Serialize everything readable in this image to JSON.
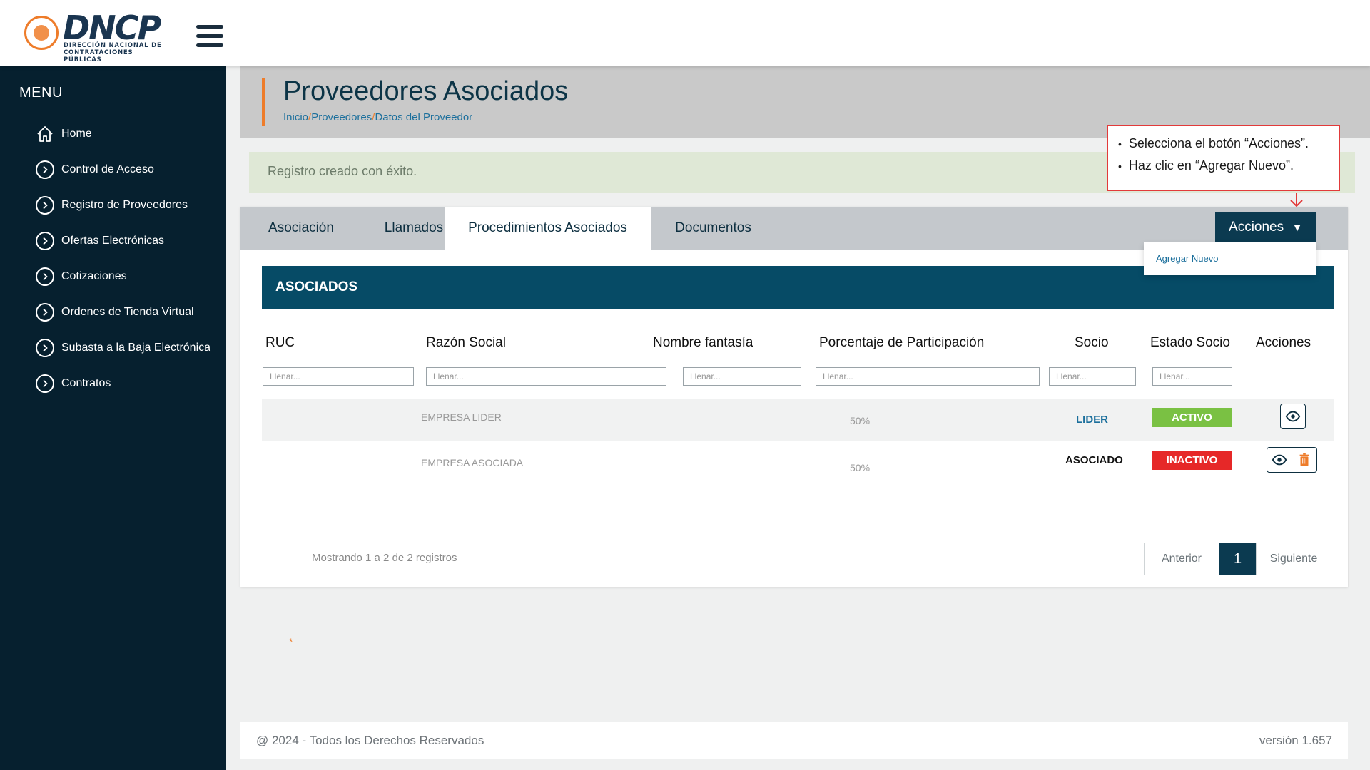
{
  "brand": {
    "logo_name": "DNCP",
    "logo_subtitle_1": "DIRECCIÓN NACIONAL DE",
    "logo_subtitle_2": "CONTRATACIONES PÚBLICAS",
    "accent_color": "#ee7c2a",
    "primary_color": "#0b3a50"
  },
  "sidebar": {
    "title": "MENU",
    "items": [
      {
        "label": "Home",
        "icon": "home-icon"
      },
      {
        "label": "Control de Acceso",
        "icon": "chevron-right-circle-icon"
      },
      {
        "label": "Registro de Proveedores",
        "icon": "chevron-right-circle-icon"
      },
      {
        "label": "Ofertas Electrónicas",
        "icon": "chevron-right-circle-icon"
      },
      {
        "label": "Cotizaciones",
        "icon": "chevron-right-circle-icon"
      },
      {
        "label": "Ordenes de Tienda Virtual",
        "icon": "chevron-right-circle-icon"
      },
      {
        "label": "Subasta a la Baja Electrónica",
        "icon": "chevron-right-circle-icon"
      },
      {
        "label": "Contratos",
        "icon": "chevron-right-circle-icon"
      }
    ]
  },
  "header": {
    "title": "Proveedores Asociados",
    "breadcrumb": [
      "Inicio",
      "Proveedores",
      "Datos del Proveedor"
    ],
    "separator": "/"
  },
  "alert": {
    "message": "Registro creado con éxito."
  },
  "callout": {
    "steps": [
      "Selecciona el botón “Acciones”.",
      "Haz clic en “Agregar Nuevo”."
    ]
  },
  "tabs": [
    {
      "label": "Asociación",
      "active": false
    },
    {
      "label": "Llamados",
      "active": false
    },
    {
      "label": "Procedimientos Asociados",
      "active": true
    },
    {
      "label": "Documentos",
      "active": false
    }
  ],
  "actions": {
    "button_label": "Acciones",
    "caret": "▼",
    "menu_items": [
      "Agregar Nuevo"
    ]
  },
  "section": {
    "title": "ASOCIADOS"
  },
  "table": {
    "columns": [
      "RUC",
      "Razón Social",
      "Nombre fantasía",
      "Porcentaje de Participación",
      "Socio",
      "Estado Socio",
      "Acciones"
    ],
    "filter_placeholder": "Llenar...",
    "rows": [
      {
        "ruc": "",
        "razon_social": "EMPRESA LIDER",
        "nombre_fantasia": "",
        "porcentaje": "50%",
        "socio": "LIDER",
        "estado": "ACTIVO",
        "estado_color": "#7ac143"
      },
      {
        "ruc": "",
        "razon_social": "EMPRESA ASOCIADA",
        "nombre_fantasia": "",
        "porcentaje": "50%",
        "socio": "ASOCIADO",
        "estado": "INACTIVO",
        "estado_color": "#e62828"
      }
    ]
  },
  "pagination": {
    "info": "Mostrando 1 a 2 de 2 registros",
    "prev": "Anterior",
    "current": "1",
    "next": "Siguiente"
  },
  "required_mark": "*",
  "footer": {
    "copyright": "@ 2024 - Todos los Derechos Reservados",
    "version": "versión 1.657"
  }
}
